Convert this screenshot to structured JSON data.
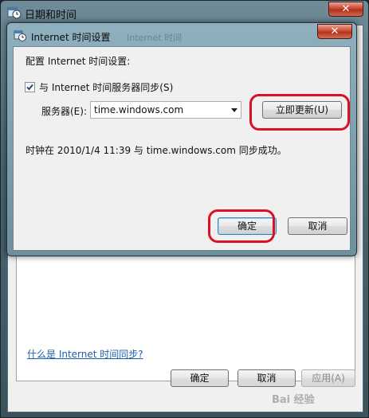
{
  "outer_window": {
    "title": "日期和时间",
    "close_glyph": "✕",
    "tab_hint": "Internet 时间",
    "link": "什么是 Internet 时间同步?",
    "buttons": {
      "ok": "确定",
      "cancel": "取消",
      "apply": "应用(A)"
    }
  },
  "dialog": {
    "title": "Internet 时间设置",
    "title_ghost": "Internet 时间",
    "close_glyph": "✕",
    "heading": "配置 Internet 时间设置:",
    "sync_checkbox": {
      "label": "与 Internet 时间服务器同步(S)",
      "checked": true
    },
    "server_label": "服务器(E):",
    "server_value": "time.windows.com",
    "update_button": "立即更新(U)",
    "status_text": "时钟在 2010/1/4 11:39 与 time.windows.com 同步成功。",
    "ok_button": "确定",
    "cancel_button": "取消"
  },
  "watermark": "Bai 经验",
  "colors": {
    "highlight_ring": "#d81220",
    "link": "#1d5fad"
  },
  "icons": {
    "window": "datetime-icon",
    "dialog": "internet-time-icon",
    "check": "checkmark-icon"
  }
}
